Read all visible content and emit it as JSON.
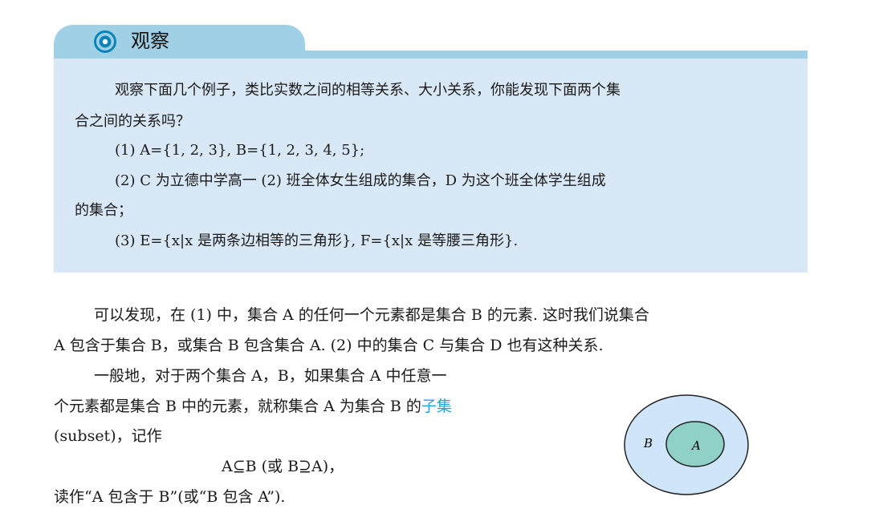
{
  "observe": {
    "title": "观察",
    "lines": [
      "观察下面几个例子，类比实数之间的相等关系、大小关系，你能发现下面两个集",
      "合之间的关系吗？",
      "(1) A={1, 2, 3}, B={1, 2, 3, 4, 5};",
      "(2) C 为立德中学高一 (2) 班全体女生组成的集合，D 为这个班全体学生组成",
      "的集合；",
      "(3) E={x|x 是两条边相等的三角形}, F={x|x 是等腰三角形}."
    ]
  },
  "body": {
    "lines": [
      "可以发现，在 (1) 中，集合 A 的任何一个元素都是集合 B 的元素. 这时我们说集合",
      "A 包含于集合 B，或集合 B 包含集合 A. (2) 中的集合 C 与集合 D 也有这种关系.",
      "一般地，对于两个集合 A，B，如果集合 A 中任意一",
      "(subset)，记作",
      "A⊆B (或 B⊇A)，",
      "读作“A 包含于 B”(或“B 包含 A”)."
    ],
    "line4_prefix": "个元素都是集合 B 中的元素，就称集合 A 为集合 B 的",
    "term": "子集"
  },
  "venn": {
    "outer_label": "B",
    "inner_label": "A",
    "outer_fill": "#cfe6fa",
    "inner_fill": "#8fd1c6"
  },
  "colors": {
    "tab": "#9fd0e6",
    "box": "#d9e8f7",
    "icon": "#0d84b8",
    "term": "#1aa4dc"
  }
}
